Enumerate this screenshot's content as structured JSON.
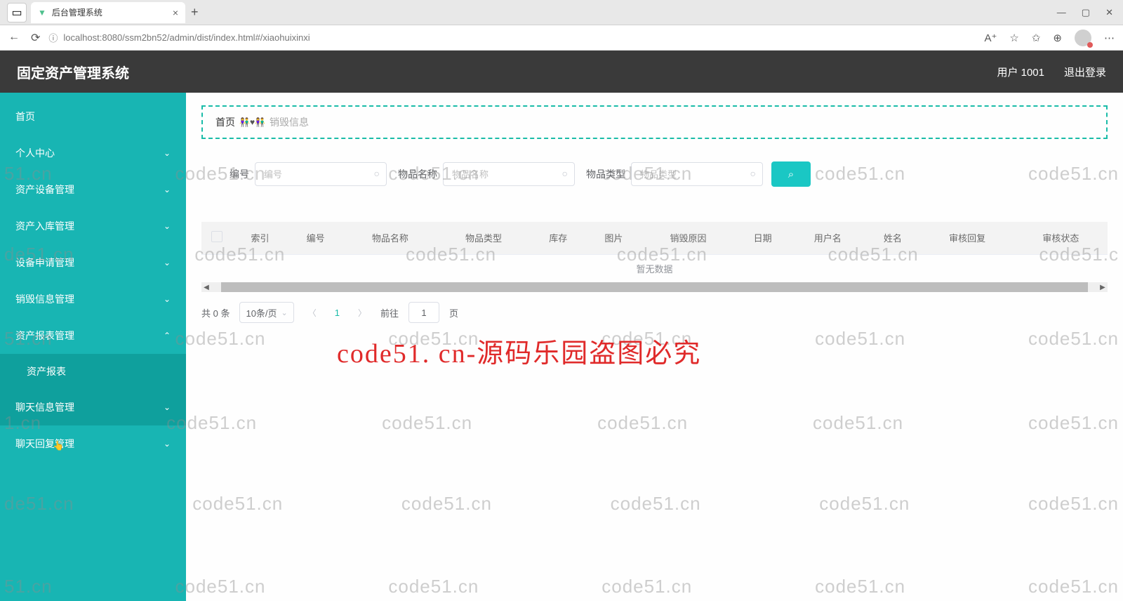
{
  "browser": {
    "tab_title": "后台管理系统",
    "url": "localhost:8080/ssm2bn52/admin/dist/index.html#/xiaohuixinxi"
  },
  "header": {
    "app_title": "固定资产管理系统",
    "user_label": "用户 1001",
    "logout": "退出登录"
  },
  "sidebar": {
    "items": [
      {
        "label": "首页",
        "expandable": false
      },
      {
        "label": "个人中心",
        "expandable": true
      },
      {
        "label": "资产设备管理",
        "expandable": true
      },
      {
        "label": "资产入库管理",
        "expandable": true
      },
      {
        "label": "设备申请管理",
        "expandable": true
      },
      {
        "label": "销毁信息管理",
        "expandable": true
      },
      {
        "label": "资产报表管理",
        "expandable": true,
        "open": true
      },
      {
        "label": "资产报表",
        "sub": true
      },
      {
        "label": "聊天信息管理",
        "expandable": true,
        "active": true
      },
      {
        "label": "聊天回复管理",
        "expandable": true
      }
    ]
  },
  "breadcrumb": {
    "home": "首页",
    "current": "销毁信息"
  },
  "search": {
    "fields": [
      {
        "label": "编号",
        "placeholder": "编号"
      },
      {
        "label": "物品名称",
        "placeholder": "物品名称"
      },
      {
        "label": "物品类型",
        "placeholder": "物品类型"
      }
    ]
  },
  "table": {
    "columns": [
      "索引",
      "编号",
      "物品名称",
      "物品类型",
      "库存",
      "图片",
      "销毁原因",
      "日期",
      "用户名",
      "姓名",
      "审核回复",
      "审核状态"
    ],
    "empty_text": "暂无数据"
  },
  "pagination": {
    "total": "共 0 条",
    "page_size": "10条/页",
    "current": "1",
    "jump_prefix": "前往",
    "jump_input": "1",
    "jump_suffix": "页"
  },
  "watermark": {
    "text": "code51.cn",
    "overlay": "code51. cn-源码乐园盗图必究"
  }
}
